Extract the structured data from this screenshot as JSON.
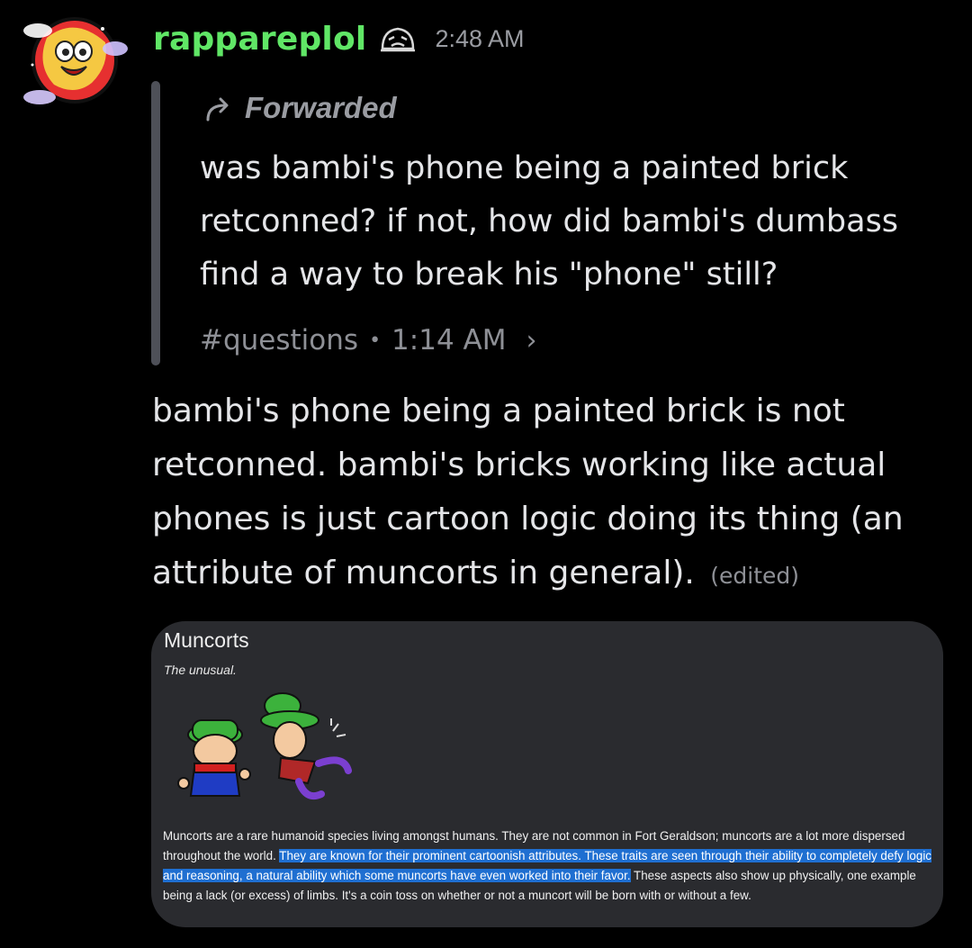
{
  "message": {
    "username": "rappareplol",
    "timestamp": "2:48 AM",
    "text": "bambi's phone being a painted brick is not retconned. bambi's bricks working like actual phones is just cartoon logic doing its thing (an attribute of muncorts in general).",
    "edited_label": "(edited)"
  },
  "forwarded": {
    "label": "Forwarded",
    "text": "was bambi's phone being a painted brick retconned? if not, how did bambi's dumbass find a way to break his \"phone\" still?",
    "channel": "#questions",
    "separator": "•",
    "time": "1:14 AM",
    "chevron": "›"
  },
  "attachment": {
    "title": "Muncorts",
    "subtitle": "The unusual.",
    "body_before": "Muncorts are a rare humanoid species living amongst humans. They are not common in Fort Geraldson; muncorts are a lot more dispersed throughout the world. ",
    "body_highlight": "They are known for their prominent cartoonish attributes. These traits are seen through their ability to completely defy logic and reasoning, a natural ability which some muncorts have even worked into their favor.",
    "body_after": " These aspects also show up physically, one example being a lack (or excess) of limbs. It's a coin toss on whether or not a muncort will be born with or without a few."
  },
  "icons": [
    "avatar",
    "emoji-badge-icon",
    "forward-arrow-icon",
    "chevron-right-icon",
    "muncort-illustration"
  ],
  "colors": {
    "username": "#60e666",
    "background": "#000000",
    "quote_bar": "#4e5058",
    "highlight": "#1f6fd1"
  }
}
